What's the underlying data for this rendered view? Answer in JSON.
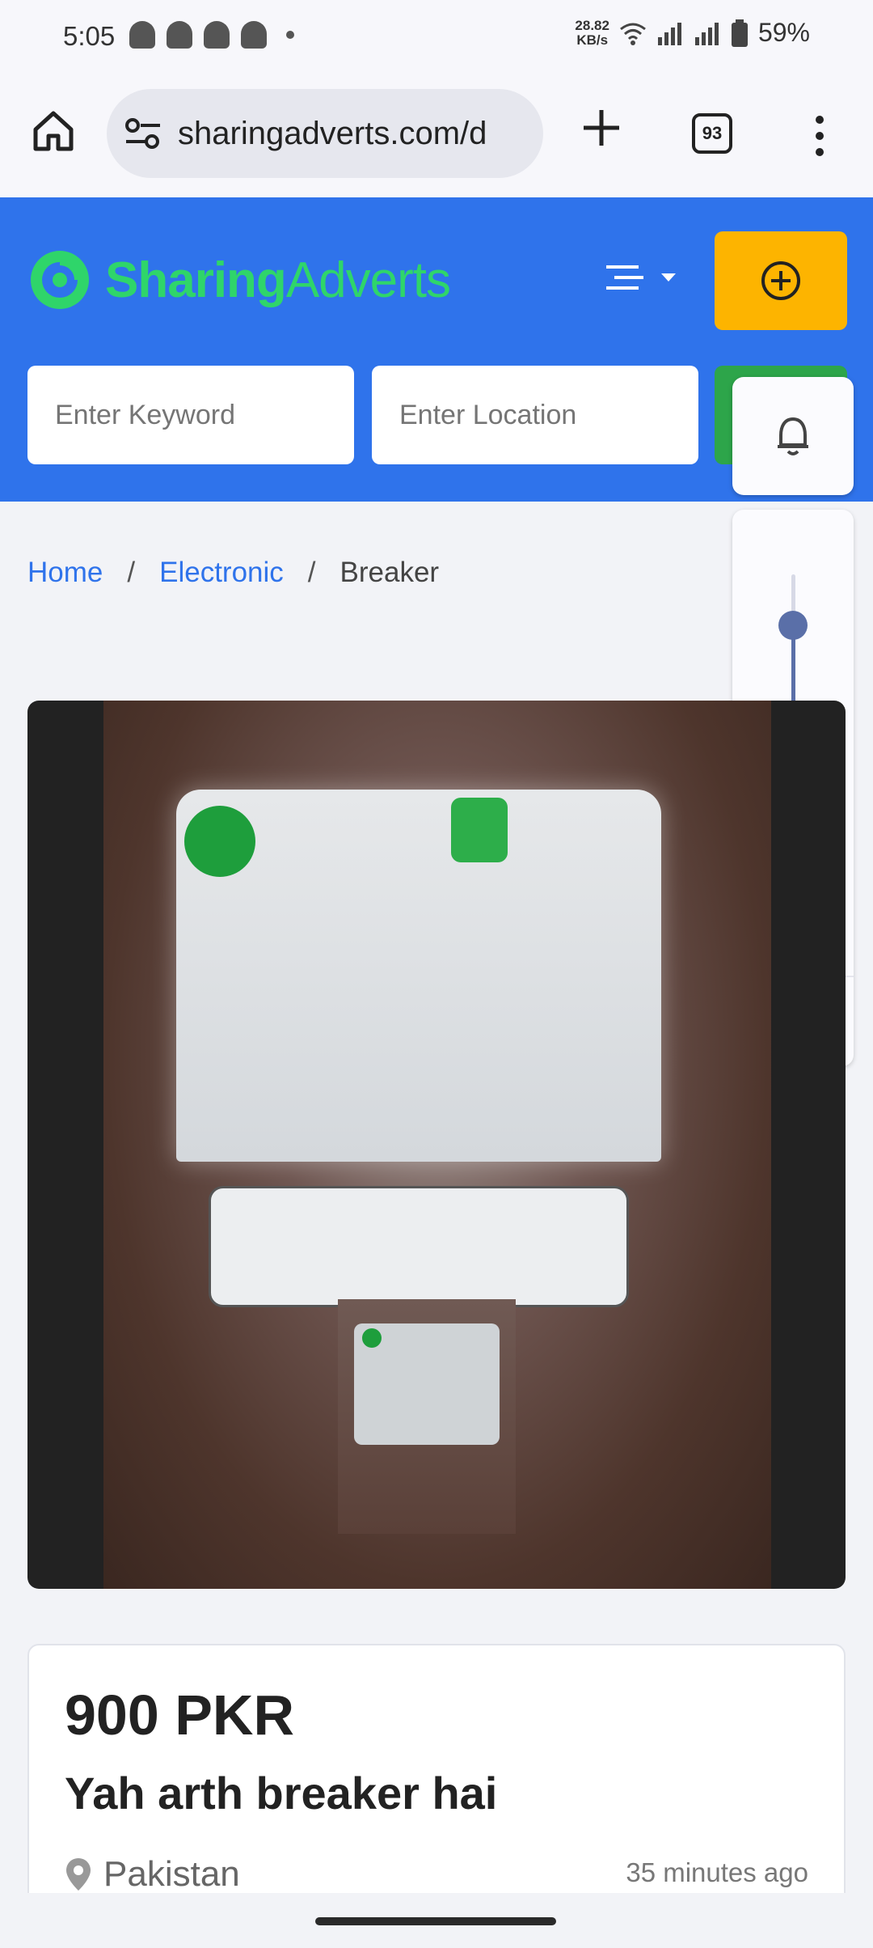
{
  "status_bar": {
    "time": "5:05",
    "net_speed_value": "28.82",
    "net_speed_unit": "KB/s",
    "battery": "59%",
    "notification_icons": [
      "snapchat-icon",
      "snapchat-icon",
      "snapchat-icon",
      "snapchat-icon"
    ]
  },
  "browser": {
    "url": "sharingadverts.com/d",
    "tab_count": "93"
  },
  "site": {
    "logo_part1": "Sharing",
    "logo_part2": "Adverts",
    "brand_color": "#2f73eb",
    "accent_green": "#2fd56a",
    "post_button_color": "#fdb400",
    "keyword_placeholder": "Enter Keyword",
    "location_placeholder": "Enter Location"
  },
  "volume_panel": {
    "level": 0.78
  },
  "breadcrumb": {
    "home": "Home",
    "category": "Electronic",
    "current": "Breaker",
    "separator": "/"
  },
  "listing": {
    "price": "900 PKR",
    "title": "Yah arth breaker hai",
    "location": "Pakistan",
    "posted": "35 minutes ago"
  }
}
